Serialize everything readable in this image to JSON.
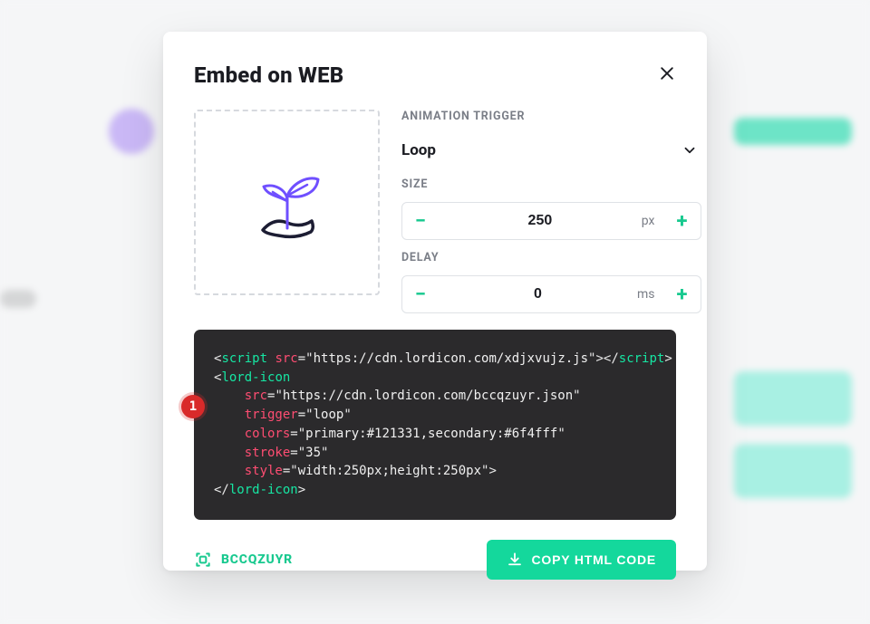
{
  "modal": {
    "title": "Embed on WEB"
  },
  "controls": {
    "trigger_label": "ANIMATION TRIGGER",
    "trigger_value": "Loop",
    "size_label": "SIZE",
    "size_value": "250",
    "size_unit": "px",
    "delay_label": "DELAY",
    "delay_value": "0",
    "delay_unit": "ms"
  },
  "code": {
    "script_src": "https://cdn.lordicon.com/xdjxvujz.js",
    "icon_tag": "lord-icon",
    "icon_src": "https://cdn.lordicon.com/bccqzuyr.json",
    "trigger_attr": "loop",
    "colors_attr": "primary:#121331,secondary:#6f4fff",
    "stroke_attr": "35",
    "style_attr": "width:250px;height:250px"
  },
  "badge": "1",
  "footer": {
    "icon_id": "BCCQZUYR",
    "copy_label": "COPY HTML CODE"
  }
}
